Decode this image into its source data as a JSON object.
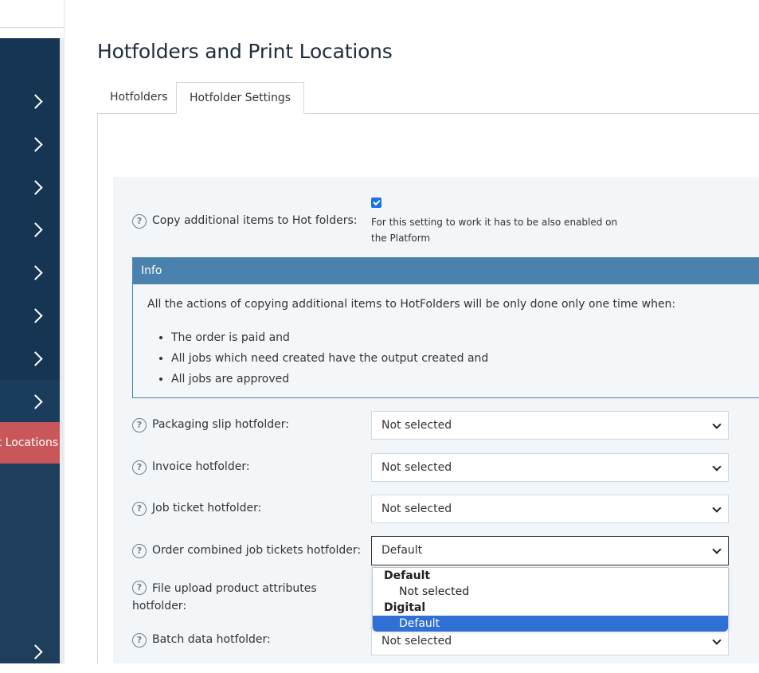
{
  "sidebar": {
    "active_label": "Print Locations"
  },
  "page": {
    "title": "Hotfolders and Print Locations"
  },
  "tabs": [
    {
      "label": "Hotfolders",
      "active": false
    },
    {
      "label": "Hotfolder Settings",
      "active": true
    }
  ],
  "settings": {
    "copy_additional": {
      "label": "Copy additional items to Hot folders:",
      "checked": true,
      "hint": "For this setting to work it has to be also enabled on the Platform"
    },
    "info": {
      "title": "Info",
      "text": "All the actions of copying additional items to HotFolders will be only done only one time when:",
      "items": [
        "The order is paid and",
        "All jobs which need created have the output created and",
        "All jobs are approved"
      ]
    },
    "packaging_slip": {
      "label": "Packaging slip hotfolder:",
      "value": "Not selected"
    },
    "invoice": {
      "label": "Invoice hotfolder:",
      "value": "Not selected"
    },
    "job_ticket": {
      "label": "Job ticket hotfolder:",
      "value": "Not selected"
    },
    "order_combined": {
      "label": "Order combined job tickets hotfolder:",
      "value": "Default"
    },
    "file_upload": {
      "label": "File upload product attributes hotfolder:"
    },
    "batch_data": {
      "label": "Batch data hotfolder:",
      "value": "Not selected"
    }
  },
  "dropdown": {
    "groups": [
      {
        "label": "Default",
        "options": [
          "Not selected"
        ]
      },
      {
        "label": "Digital",
        "options": [
          "Default"
        ]
      }
    ],
    "highlighted": "Default"
  },
  "colors": {
    "sidebar_bg": "#153553",
    "active_item": "#c9575a",
    "info_header": "#4a82ad",
    "highlight": "#2f6fd6"
  }
}
